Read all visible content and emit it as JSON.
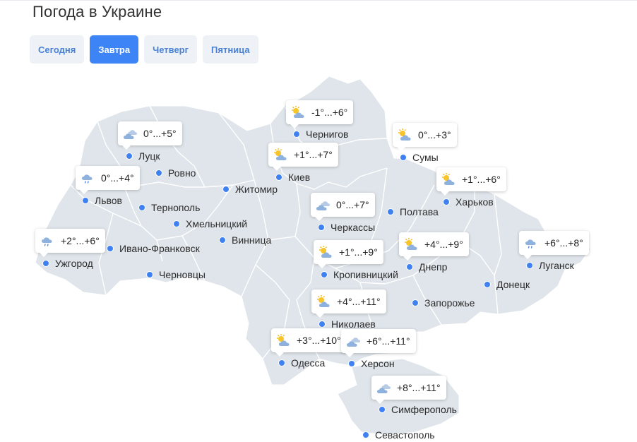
{
  "page": {
    "title": "Погода в Украине"
  },
  "tabs": [
    {
      "label": "Сегодня",
      "active": false
    },
    {
      "label": "Завтра",
      "active": true
    },
    {
      "label": "Четверг",
      "active": false
    },
    {
      "label": "Пятница",
      "active": false
    }
  ],
  "colors": {
    "map_fill": "#dfe5ea",
    "map_border": "#ffffff",
    "dot": "#3f81f1",
    "active_tab": "#3d84f7"
  },
  "cities": [
    {
      "id": "lutsk",
      "name": "Луцк",
      "forecast": "0°...+5°",
      "icon": "partly-cloudy-icon"
    },
    {
      "id": "rovno",
      "name": "Ровно"
    },
    {
      "id": "lviv",
      "name": "Львов",
      "forecast": "0°...+4°",
      "icon": "rain-icon"
    },
    {
      "id": "ternopil",
      "name": "Тернополь"
    },
    {
      "id": "uzhgorod",
      "name": "Ужгород",
      "forecast": "+2°...+6°",
      "icon": "rain-icon"
    },
    {
      "id": "ivano",
      "name": "Ивано-Франковск"
    },
    {
      "id": "khmelnitsky",
      "name": "Хмельницкий"
    },
    {
      "id": "chernivtsi",
      "name": "Черновцы"
    },
    {
      "id": "zhytomyr",
      "name": "Житомир"
    },
    {
      "id": "vinnytsia",
      "name": "Винница"
    },
    {
      "id": "chernihiv",
      "name": "Чернигов",
      "forecast": "-1°...+6°",
      "icon": "sun-cloud-icon"
    },
    {
      "id": "kyiv",
      "name": "Киев",
      "forecast": "+1°...+7°",
      "icon": "sun-cloud-icon"
    },
    {
      "id": "sumy",
      "name": "Сумы",
      "forecast": "0°...+3°",
      "icon": "sun-cloud-icon"
    },
    {
      "id": "kharkiv",
      "name": "Харьков",
      "forecast": "+1°...+6°",
      "icon": "sun-cloud-icon"
    },
    {
      "id": "cherkasy",
      "name": "Черкассы",
      "forecast": "0°...+7°",
      "icon": "partly-cloudy-icon"
    },
    {
      "id": "poltava",
      "name": "Полтава"
    },
    {
      "id": "kropyvnytskyi",
      "name": "Кропивницкий",
      "forecast": "+1°...+9°",
      "icon": "sun-cloud-icon"
    },
    {
      "id": "dnipro",
      "name": "Днепр",
      "forecast": "+4°...+9°",
      "icon": "sun-cloud-icon"
    },
    {
      "id": "luhansk",
      "name": "Луганск",
      "forecast": "+6°...+8°",
      "icon": "rain-icon"
    },
    {
      "id": "donetsk",
      "name": "Донецк"
    },
    {
      "id": "zaporizhzhia",
      "name": "Запорожье"
    },
    {
      "id": "mykolaiv",
      "name": "Николаев",
      "forecast": "+4°...+11°",
      "icon": "sun-cloud-icon"
    },
    {
      "id": "odesa",
      "name": "Одесса",
      "forecast": "+3°...+10°",
      "icon": "sun-cloud-icon"
    },
    {
      "id": "kherson",
      "name": "Херсон",
      "forecast": "+6°...+11°",
      "icon": "partly-cloudy-icon"
    },
    {
      "id": "simferopol",
      "name": "Симферополь",
      "forecast": "+8°...+11°",
      "icon": "partly-cloudy-icon"
    },
    {
      "id": "sevastopol",
      "name": "Севастополь"
    }
  ]
}
